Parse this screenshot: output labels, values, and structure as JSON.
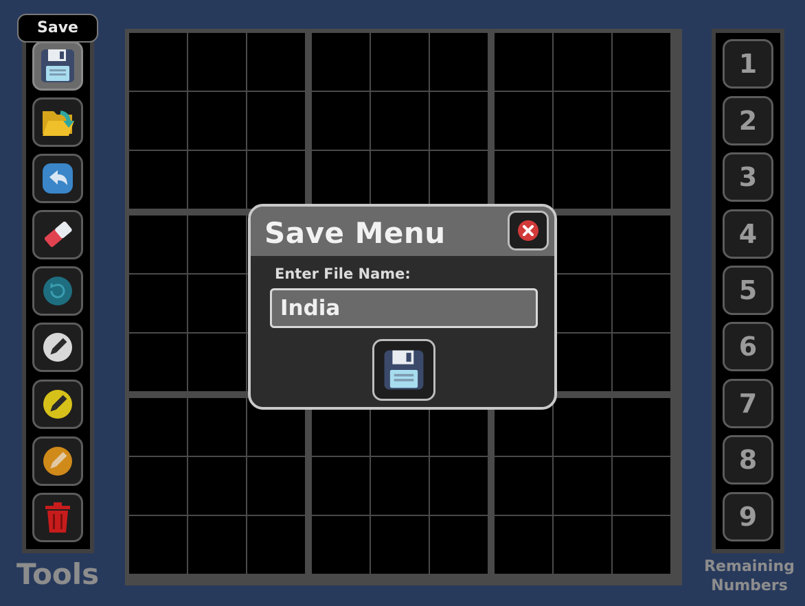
{
  "tooltip": "Save",
  "tools": {
    "label": "Tools",
    "buttons": [
      {
        "name": "save",
        "icon": "floppy-disk-icon"
      },
      {
        "name": "load",
        "icon": "folder-open-icon"
      },
      {
        "name": "undo",
        "icon": "undo-arrow-icon"
      },
      {
        "name": "eraser",
        "icon": "eraser-icon"
      },
      {
        "name": "reset",
        "icon": "reset-icon"
      },
      {
        "name": "pencil-white",
        "icon": "pencil-icon",
        "color": "#d8d8d8"
      },
      {
        "name": "pencil-yellow",
        "icon": "pencil-icon",
        "color": "#d6c11a"
      },
      {
        "name": "pencil-orange",
        "icon": "pencil-icon",
        "color": "#d08a1a"
      },
      {
        "name": "delete",
        "icon": "trash-icon"
      }
    ]
  },
  "numbers": {
    "label_line1": "Remaining",
    "label_line2": "Numbers",
    "items": [
      "1",
      "2",
      "3",
      "4",
      "5",
      "6",
      "7",
      "8",
      "9"
    ]
  },
  "dialog": {
    "title": "Save Menu",
    "file_label": "Enter File Name:",
    "file_value": "India"
  },
  "colors": {
    "background": "#283a5c",
    "board_lines": "#4a4a4a",
    "cell": "#000000"
  }
}
